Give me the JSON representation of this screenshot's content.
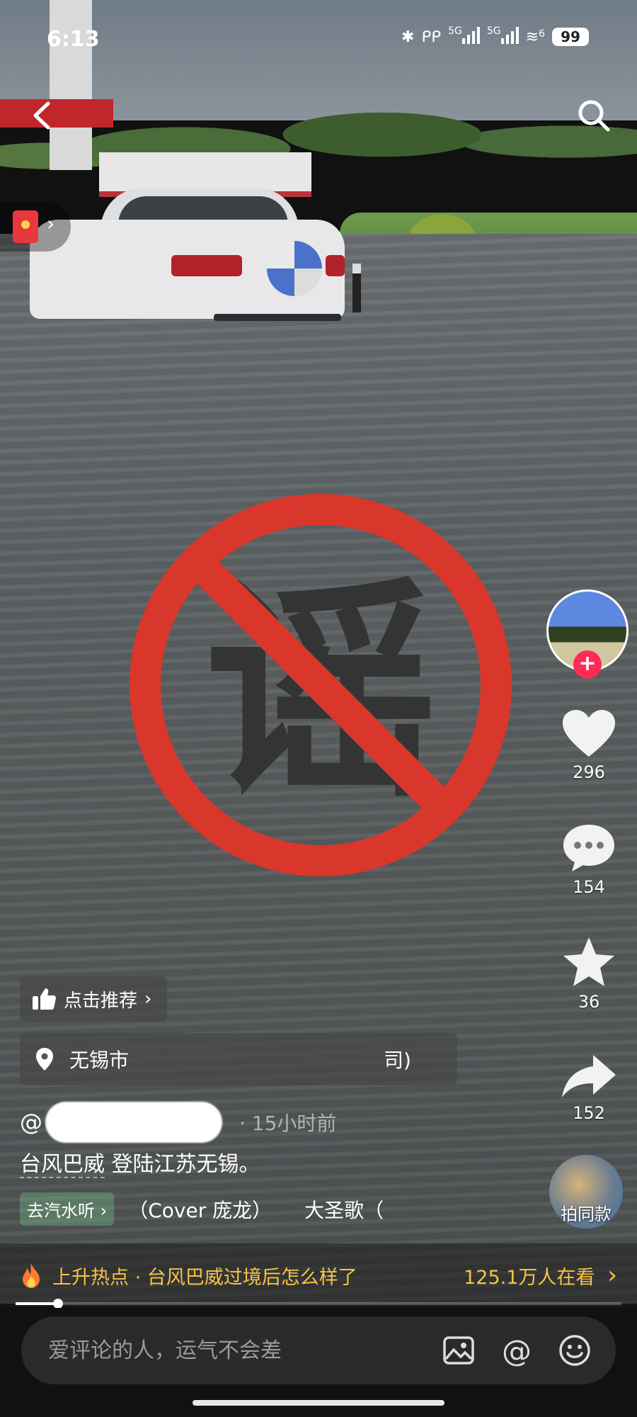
{
  "status_bar": {
    "time": "6:13",
    "network": "5G",
    "battery": "99",
    "sim_index": "6"
  },
  "video_overlay": {
    "rumor_char": "谣",
    "sign_color": "#d9372b",
    "char_color": "#343434"
  },
  "actions": {
    "likes": "296",
    "comments": "154",
    "favorites": "36",
    "shares": "152",
    "same_style_label": "拍同款"
  },
  "recommend": {
    "label": "点击推荐"
  },
  "location": {
    "city": "无锡市",
    "suffix": "司)"
  },
  "post": {
    "author_prefix": "@",
    "time_ago": "· 15小时前",
    "caption_link": "台风巴威",
    "caption_rest": "登陆江苏无锡。"
  },
  "music": {
    "tag": "去汽水听",
    "track_1": "（Cover 庞龙）",
    "track_2": "大圣歌（"
  },
  "hot_topic": {
    "label": "上升热点 · 台风巴威过境后怎么样了",
    "viewers": "125.1万人在看",
    "color": "#f6c343"
  },
  "playback": {
    "progress": 0.07
  },
  "comment_input": {
    "placeholder": "爱评论的人，运气不会差"
  }
}
